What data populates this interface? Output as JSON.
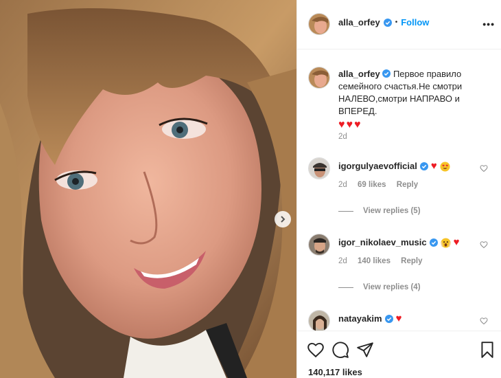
{
  "post": {
    "author": "alla_orfey",
    "follow_separator": "•",
    "follow_label": "Follow",
    "more_label": "•••",
    "caption": {
      "username": "alla_orfey",
      "text": "Первое правило семейного счастья.Не смотри НАЛЕВО,смотри НАПРАВО и ВПЕРЕД.",
      "emoji": "♥♥♥",
      "time": "2d"
    },
    "likes": "140,117 likes"
  },
  "comments": [
    {
      "username": "igorgulyaevofficial",
      "verified": true,
      "emoji": "♥",
      "time": "2d",
      "likes": "69 likes",
      "reply_label": "Reply",
      "view_replies": "View replies (5)"
    },
    {
      "username": "igor_nikolaev_music",
      "verified": true,
      "emoji": "♥",
      "time": "2d",
      "likes": "140 likes",
      "reply_label": "Reply",
      "view_replies": "View replies (4)"
    },
    {
      "username": "natayakim",
      "verified": true,
      "emoji": "♥"
    }
  ],
  "icons": {
    "verified": "verified-badge-icon",
    "like": "heart-outline-icon",
    "comment": "comment-bubble-icon",
    "share": "paper-plane-icon",
    "save": "bookmark-icon",
    "next": "chevron-right-icon"
  },
  "colors": {
    "accent": "#0095f6",
    "heart": "#ed1c24",
    "muted": "#8e8e8e"
  }
}
